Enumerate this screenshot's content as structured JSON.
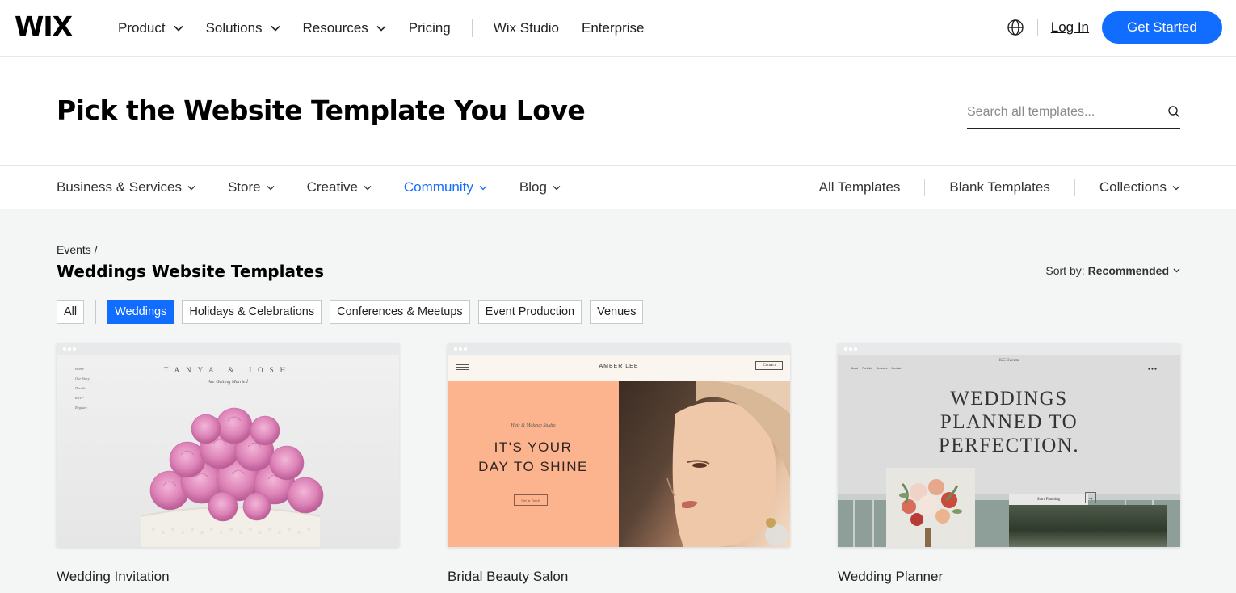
{
  "topnav": {
    "logo": "WIX",
    "items": [
      {
        "label": "Product",
        "dropdown": true
      },
      {
        "label": "Solutions",
        "dropdown": true
      },
      {
        "label": "Resources",
        "dropdown": true
      },
      {
        "label": "Pricing",
        "dropdown": false
      }
    ],
    "secondary_items": [
      "Wix Studio",
      "Enterprise"
    ],
    "login_label": "Log In",
    "cta_label": "Get Started",
    "accent_color": "#116dff"
  },
  "hero": {
    "title": "Pick the Website Template You Love",
    "search_placeholder": "Search all templates..."
  },
  "categories": {
    "items": [
      {
        "label": "Business & Services",
        "active": false
      },
      {
        "label": "Store",
        "active": false
      },
      {
        "label": "Creative",
        "active": false
      },
      {
        "label": "Community",
        "active": true
      },
      {
        "label": "Blog",
        "active": false
      }
    ],
    "right_links": [
      "All Templates",
      "Blank Templates",
      "Collections"
    ]
  },
  "content": {
    "breadcrumb": "Events /",
    "page_title": "Weddings Website Templates",
    "sort_label": "Sort by:",
    "sort_value": "Recommended",
    "filters": [
      {
        "label": "All",
        "active": false
      },
      {
        "label": "Weddings",
        "active": true
      },
      {
        "label": "Holidays & Celebrations",
        "active": false
      },
      {
        "label": "Conferences & Meetups",
        "active": false
      },
      {
        "label": "Event Production",
        "active": false
      },
      {
        "label": "Venues",
        "active": false
      }
    ]
  },
  "cards": [
    {
      "title": "Wedding Invitation",
      "preview": {
        "names": "TANYA & JOSH",
        "subtitle": "Are Getting Married",
        "menu": [
          "Home",
          "Our Story",
          "Details",
          "RSVP",
          "Registry"
        ]
      }
    },
    {
      "title": "Bridal Beauty Salon",
      "preview": {
        "brand": "AMBER LEE",
        "contact": "Contact",
        "small": "Hair & Makeup Studio",
        "headline_1": "IT'S YOUR",
        "headline_2": "DAY TO SHINE",
        "button": "Get in Touch"
      }
    },
    {
      "title": "Wedding Planner",
      "preview": {
        "logo": "KC Events",
        "nav": "About Portfolio Services Contact",
        "headline_1": "WEDDINGS",
        "headline_2": "PLANNED TO",
        "headline_3": "PERFECTION.",
        "button": "Start Planning"
      }
    }
  ]
}
